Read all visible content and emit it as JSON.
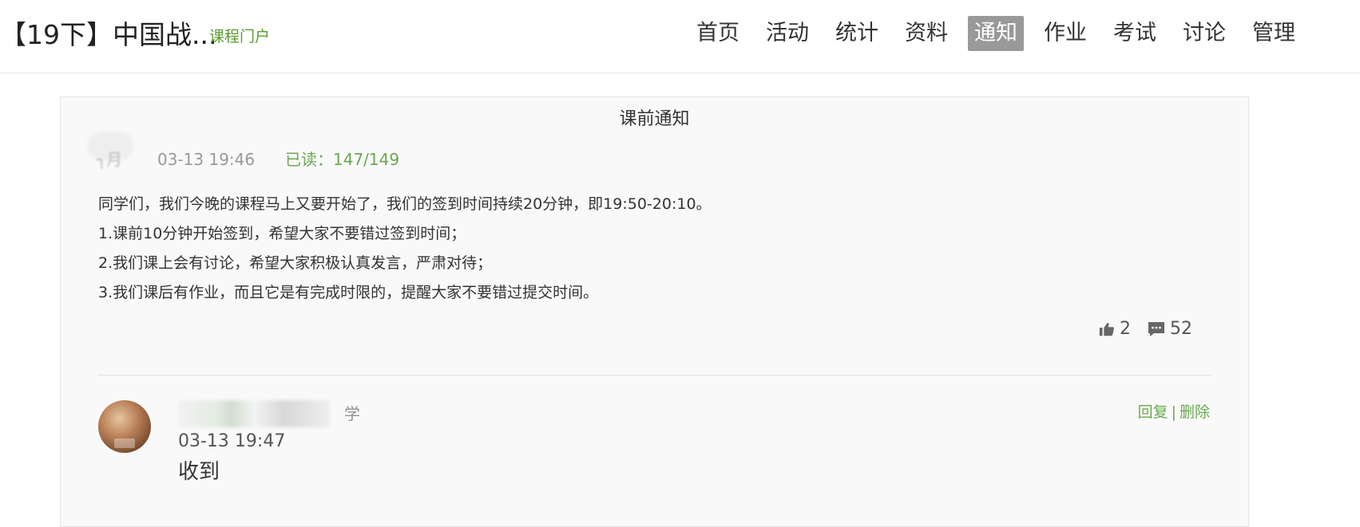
{
  "header": {
    "course_title": "【19下】中国战...",
    "portal_link": "课程门户",
    "nav": [
      {
        "label": "首页",
        "active": false
      },
      {
        "label": "活动",
        "active": false
      },
      {
        "label": "统计",
        "active": false
      },
      {
        "label": "资料",
        "active": false
      },
      {
        "label": "通知",
        "active": true
      },
      {
        "label": "作业",
        "active": false
      },
      {
        "label": "考试",
        "active": false
      },
      {
        "label": "讨论",
        "active": false
      },
      {
        "label": "管理",
        "active": false
      }
    ]
  },
  "notice": {
    "title": "课前通知",
    "time": "03-13 19:46",
    "read_count": "已读：147/149",
    "body": [
      "同学们，我们今晚的课程马上又要开始了，我们的签到时间持续20分钟，即19:50-20:10。",
      "1.课前10分钟开始签到，希望大家不要错过签到时间；",
      "2.我们课上会有讨论，希望大家积极认真发言，严肃对待；",
      "3.我们课后有作业，而且它是有完成时限的，提醒大家不要错过提交时间。"
    ],
    "likes": "2",
    "comments": "52"
  },
  "comment": {
    "commenter_suffix": "学",
    "time": "03-13 19:47",
    "text": "收到",
    "reply_label": "回复",
    "delete_label": "删除"
  },
  "colors": {
    "accent_green": "#6aa84f",
    "active_nav_bg": "#999999"
  },
  "icons": [
    "thumbs-up-icon",
    "comment-icon"
  ]
}
